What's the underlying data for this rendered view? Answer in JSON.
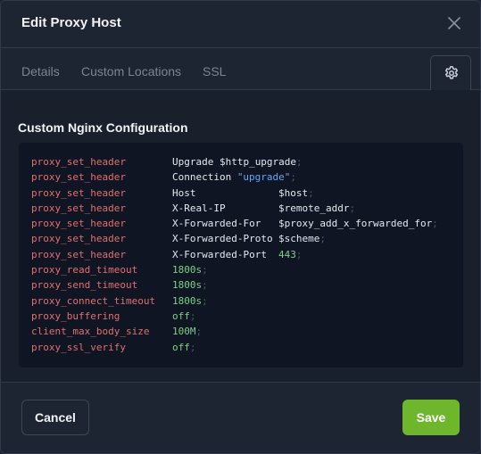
{
  "header": {
    "title": "Edit Proxy Host",
    "close_icon": "close-icon"
  },
  "tabs": [
    {
      "label": "Details"
    },
    {
      "label": "Custom Locations"
    },
    {
      "label": "SSL"
    },
    {
      "icon": "gear-icon",
      "active": true
    }
  ],
  "section": {
    "title": "Custom Nginx Configuration"
  },
  "config_lines": [
    {
      "directive": "proxy_set_header",
      "arg1": "Upgrade",
      "arg2": "$http_upgrade",
      "end": ";"
    },
    {
      "directive": "proxy_set_header",
      "arg1": "Connection",
      "arg2": "\"upgrade\"",
      "end": ";"
    },
    {
      "directive": "proxy_set_header",
      "arg1": "Host",
      "arg2": "$host",
      "end": ";"
    },
    {
      "directive": "proxy_set_header",
      "arg1": "X-Real-IP",
      "arg2": "$remote_addr",
      "end": ";"
    },
    {
      "directive": "proxy_set_header",
      "arg1": "X-Forwarded-For",
      "arg2": "$proxy_add_x_forwarded_for",
      "end": ";"
    },
    {
      "directive": "proxy_set_header",
      "arg1": "X-Forwarded-Proto",
      "arg2": "$scheme",
      "end": ";"
    },
    {
      "directive": "proxy_set_header",
      "arg1": "X-Forwarded-Port",
      "arg2": "443",
      "end": ";"
    },
    {
      "directive": "proxy_read_timeout",
      "arg1": "1800s",
      "end": ";"
    },
    {
      "directive": "proxy_send_timeout",
      "arg1": "1800s",
      "end": ";"
    },
    {
      "directive": "proxy_connect_timeout",
      "arg1": "1800s",
      "end": ";"
    },
    {
      "directive": "proxy_buffering",
      "arg1": "off",
      "end": ";"
    },
    {
      "directive": "client_max_body_size",
      "arg1": "100M",
      "end": ";"
    },
    {
      "directive": "proxy_ssl_verify",
      "arg1": "off",
      "end": ";"
    }
  ],
  "footer": {
    "cancel_label": "Cancel",
    "save_label": "Save"
  },
  "colors": {
    "accent": "#6eb62c",
    "directive": "#e2706f",
    "string": "#63a9f0",
    "number": "#7fd18a",
    "value": "#e6e9ee"
  }
}
